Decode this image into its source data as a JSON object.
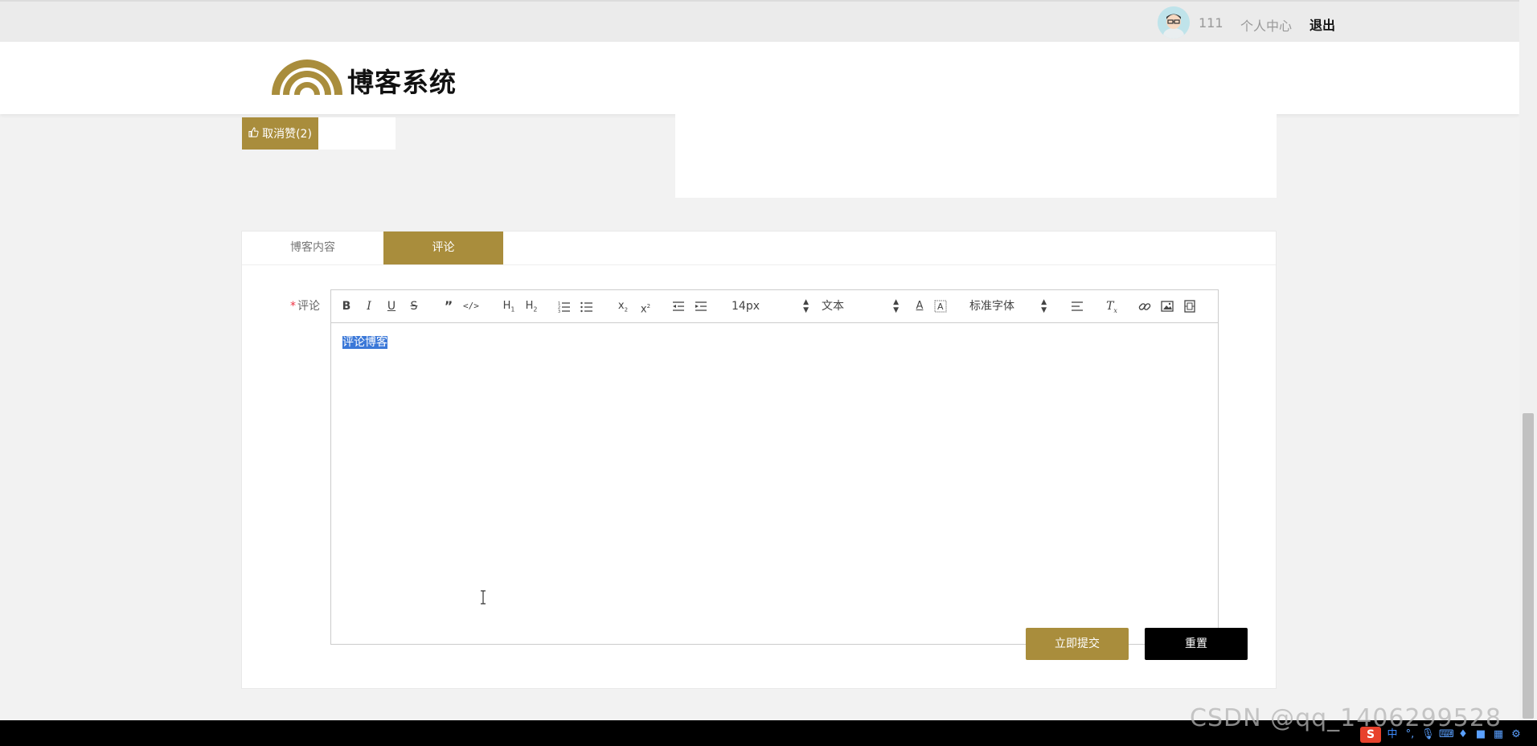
{
  "topbar": {
    "username": "111",
    "personal_center": "个人中心",
    "logout": "退出"
  },
  "header": {
    "site_title": "博客系统"
  },
  "like_button": {
    "label": "取消赞(2)"
  },
  "tabs": [
    {
      "label": "博客内容",
      "active": false
    },
    {
      "label": "评论",
      "active": true
    }
  ],
  "comment_form": {
    "field_label": "评论",
    "required_mark": "*",
    "editor_content": "评论博客",
    "toolbar": {
      "font_size": "14px",
      "block_type": "文本",
      "font_family": "标准字体"
    },
    "submit_label": "立即提交",
    "reset_label": "重置"
  },
  "watermark": "CSDN @qq_1406299528",
  "tray": {
    "ime_logo": "S",
    "ime_lang": "中"
  },
  "colors": {
    "accent": "#a98d3c",
    "selection": "#3b78d8"
  }
}
